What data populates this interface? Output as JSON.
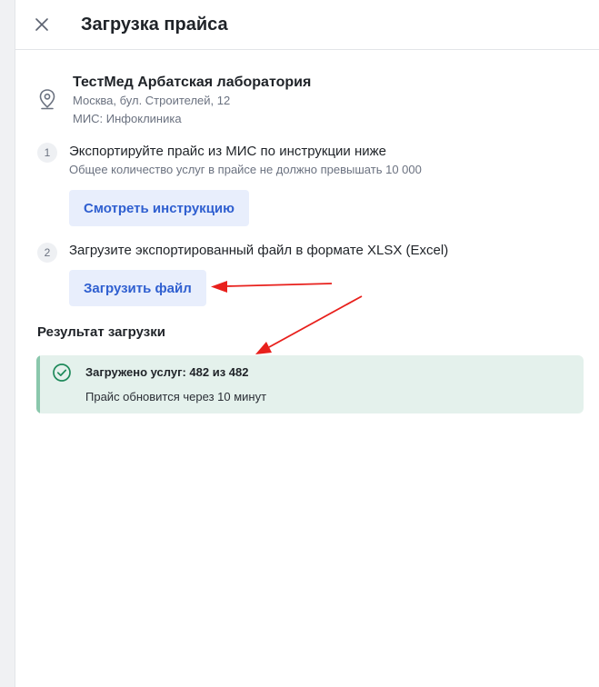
{
  "header": {
    "title": "Загрузка прайса",
    "close_icon": "close-icon"
  },
  "clinic": {
    "name": "ТестМед Арбатская лаборатория",
    "address": "Москва, бул. Строителей, 12",
    "mis": "МИС: Инфоклиника",
    "icon": "location-pin-icon"
  },
  "steps": [
    {
      "number": "1",
      "text": "Экспортируйте прайс из МИС по инструкции ниже",
      "hint": "Общее количество услуг в прайсе не должно превышать 10 000",
      "button_label": "Смотреть инструкцию"
    },
    {
      "number": "2",
      "text": "Загрузите экспортированный файл в формате XLSX (Excel)",
      "button_label": "Загрузить файл"
    }
  ],
  "result": {
    "section_title": "Результат загрузки",
    "title": "Загружено услуг: 482 из 482",
    "subtitle": "Прайс обновится через 10 минут",
    "icon": "check-circle-icon"
  },
  "colors": {
    "accent": "#2f5fd0",
    "button_bg": "#e8eefc",
    "success_bg": "#e4f1ec",
    "success_bar": "#8ac7ac",
    "success_icon": "#1f8a5b",
    "annotation_arrow": "#e8201c"
  }
}
